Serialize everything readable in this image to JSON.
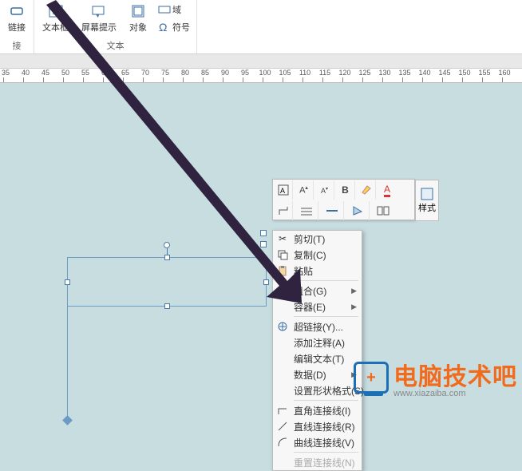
{
  "ribbon": {
    "btn_link": "链接",
    "btn_textbox": "文本框",
    "btn_screentip": "屏幕提示",
    "btn_object": "对象",
    "btn_field": "域",
    "btn_symbol": "符号",
    "group_link": "接",
    "group_text": "文本"
  },
  "ruler": {
    "marks": [
      -35,
      -40,
      -45,
      -50,
      -55,
      -60,
      -65,
      -70,
      -75,
      -80,
      -85,
      -90,
      -95,
      -100,
      -105,
      -110,
      -115,
      -120,
      -125,
      -130,
      -135,
      -140,
      -145,
      -150,
      -155,
      -160
    ]
  },
  "float_toolbar": {
    "style_label": "样式"
  },
  "context_menu": {
    "cut": "剪切(T)",
    "copy": "复制(C)",
    "paste": "粘贴",
    "group": "组合(G)",
    "container": "容器(E)",
    "hyperlink": "超链接(Y)...",
    "add_comment": "添加注释(A)",
    "edit_text": "编辑文本(T)",
    "data": "数据(D)",
    "format_shape": "设置形状格式(S)",
    "right_angle": "直角连接线(I)",
    "straight": "直线连接线(R)",
    "curved": "曲线连接线(V)",
    "reset": "重置连接线(N)"
  },
  "watermark": {
    "main": "电脑技术吧",
    "sub": "www.xiazaiba.com"
  }
}
